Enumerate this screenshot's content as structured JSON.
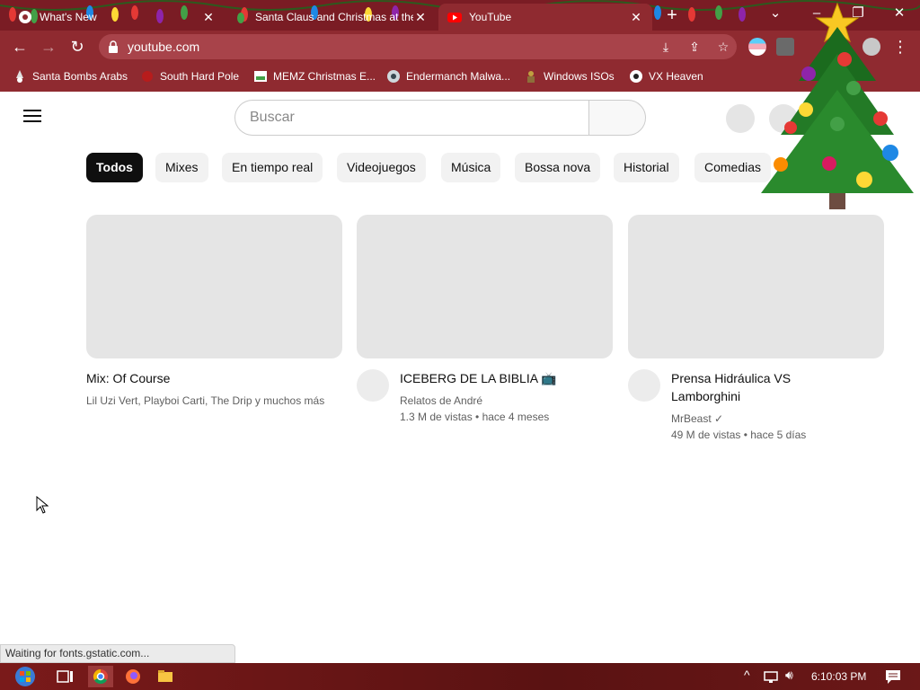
{
  "browser": {
    "tabs": [
      {
        "title": "What's New",
        "favicon": "chrome-icon"
      },
      {
        "title": "Santa Claus and Christmas at the",
        "favicon": "christmas-lights-icon"
      },
      {
        "title": "YouTube",
        "favicon": "youtube-icon",
        "active": true
      }
    ],
    "url": "youtube.com",
    "bookmarks": [
      {
        "label": "Santa Bombs Arabs",
        "icon": "santa-icon"
      },
      {
        "label": "South Hard Pole",
        "icon": "snowflake-icon"
      },
      {
        "label": "MEMZ Christmas E...",
        "icon": "memz-icon"
      },
      {
        "label": "Endermanch Malwa...",
        "icon": "endermanch-icon"
      },
      {
        "label": "Windows ISOs",
        "icon": "windows-iso-icon"
      },
      {
        "label": "VX Heaven",
        "icon": "vx-heaven-icon"
      }
    ],
    "status": "Waiting for fonts.gstatic.com..."
  },
  "youtube": {
    "search_placeholder": "Buscar",
    "chips": [
      "Todos",
      "Mixes",
      "En tiempo real",
      "Videojuegos",
      "Música",
      "Bossa nova",
      "Historial",
      "Comedias"
    ],
    "active_chip": "Todos",
    "videos": [
      {
        "title": "Mix: Of Course",
        "channel": "Lil Uzi Vert, Playboi Carti, The Drip y muchos más",
        "meta": ""
      },
      {
        "title": "ICEBERG DE LA BIBLIA 📺",
        "channel": "Relatos de André",
        "meta": "1.3 M de vistas • hace 4 meses"
      },
      {
        "title": "Prensa Hidráulica VS Lamborghini",
        "channel": "MrBeast ✓",
        "meta": "49 M de vistas • hace 5 días"
      }
    ]
  },
  "taskbar": {
    "clock": "6:10:03 PM",
    "apps": [
      "start-button",
      "task-view-icon",
      "chrome-icon",
      "firefox-icon",
      "file-explorer-icon"
    ]
  },
  "colors": {
    "chrome_frame": "#8f2a30",
    "tabstrip": "#7a1c24",
    "chip_active": "#0f0f0f",
    "chip_bg": "#f2f2f2",
    "placeholder": "#e5e5e5"
  }
}
